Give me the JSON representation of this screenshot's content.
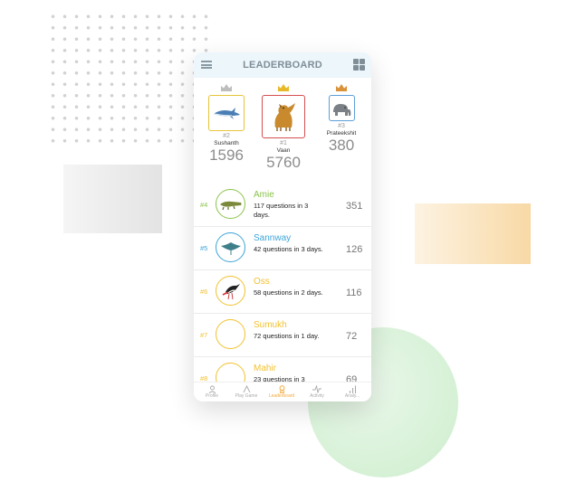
{
  "header": {
    "title": "LEADERBOARD"
  },
  "icons": {
    "menu": "hamburger-icon",
    "grid": "grid-icon",
    "crown": "crown-icon"
  },
  "colors": {
    "header_bg": "#ecf6fb",
    "rank1": "#d44f4f",
    "rank2": "#e7c43a",
    "rank3": "#5d9fd6",
    "green": "#8bc34a",
    "blue": "#3ea4d9",
    "yellow": "#f2c12e",
    "tab_active": "#f2a93b"
  },
  "podium": [
    {
      "rank": "#2",
      "name": "Sushanth",
      "score": "1596",
      "animal": "shark"
    },
    {
      "rank": "#1",
      "name": "Vaan",
      "score": "5760",
      "animal": "griffin"
    },
    {
      "rank": "#3",
      "name": "Prateekshit",
      "score": "380",
      "animal": "elephant"
    }
  ],
  "rows": [
    {
      "rank": "#4",
      "name": "Amie",
      "desc": "117 questions in 3 days.",
      "score": "351",
      "animal": "crocodile"
    },
    {
      "rank": "#5",
      "name": "Sannway",
      "desc": "42 questions in 3 days.",
      "score": "126",
      "animal": "manta-ray"
    },
    {
      "rank": "#6",
      "name": "Oss",
      "desc": "58 questions in 2 days.",
      "score": "116",
      "animal": "stork"
    },
    {
      "rank": "#7",
      "name": "Sumukh",
      "desc": "72 questions in 1 day.",
      "score": "72",
      "animal": ""
    },
    {
      "rank": "#8",
      "name": "Mahir",
      "desc": "23 questions in 3",
      "score": "69",
      "animal": ""
    }
  ],
  "tabs": [
    {
      "label": "Profile",
      "icon": "person-icon"
    },
    {
      "label": "Play Game",
      "icon": "chevron-up-icon"
    },
    {
      "label": "Leaderboard",
      "icon": "medal-icon",
      "active": true
    },
    {
      "label": "Activity",
      "icon": "activity-icon"
    },
    {
      "label": "Analy...",
      "icon": "bar-chart-icon"
    }
  ]
}
